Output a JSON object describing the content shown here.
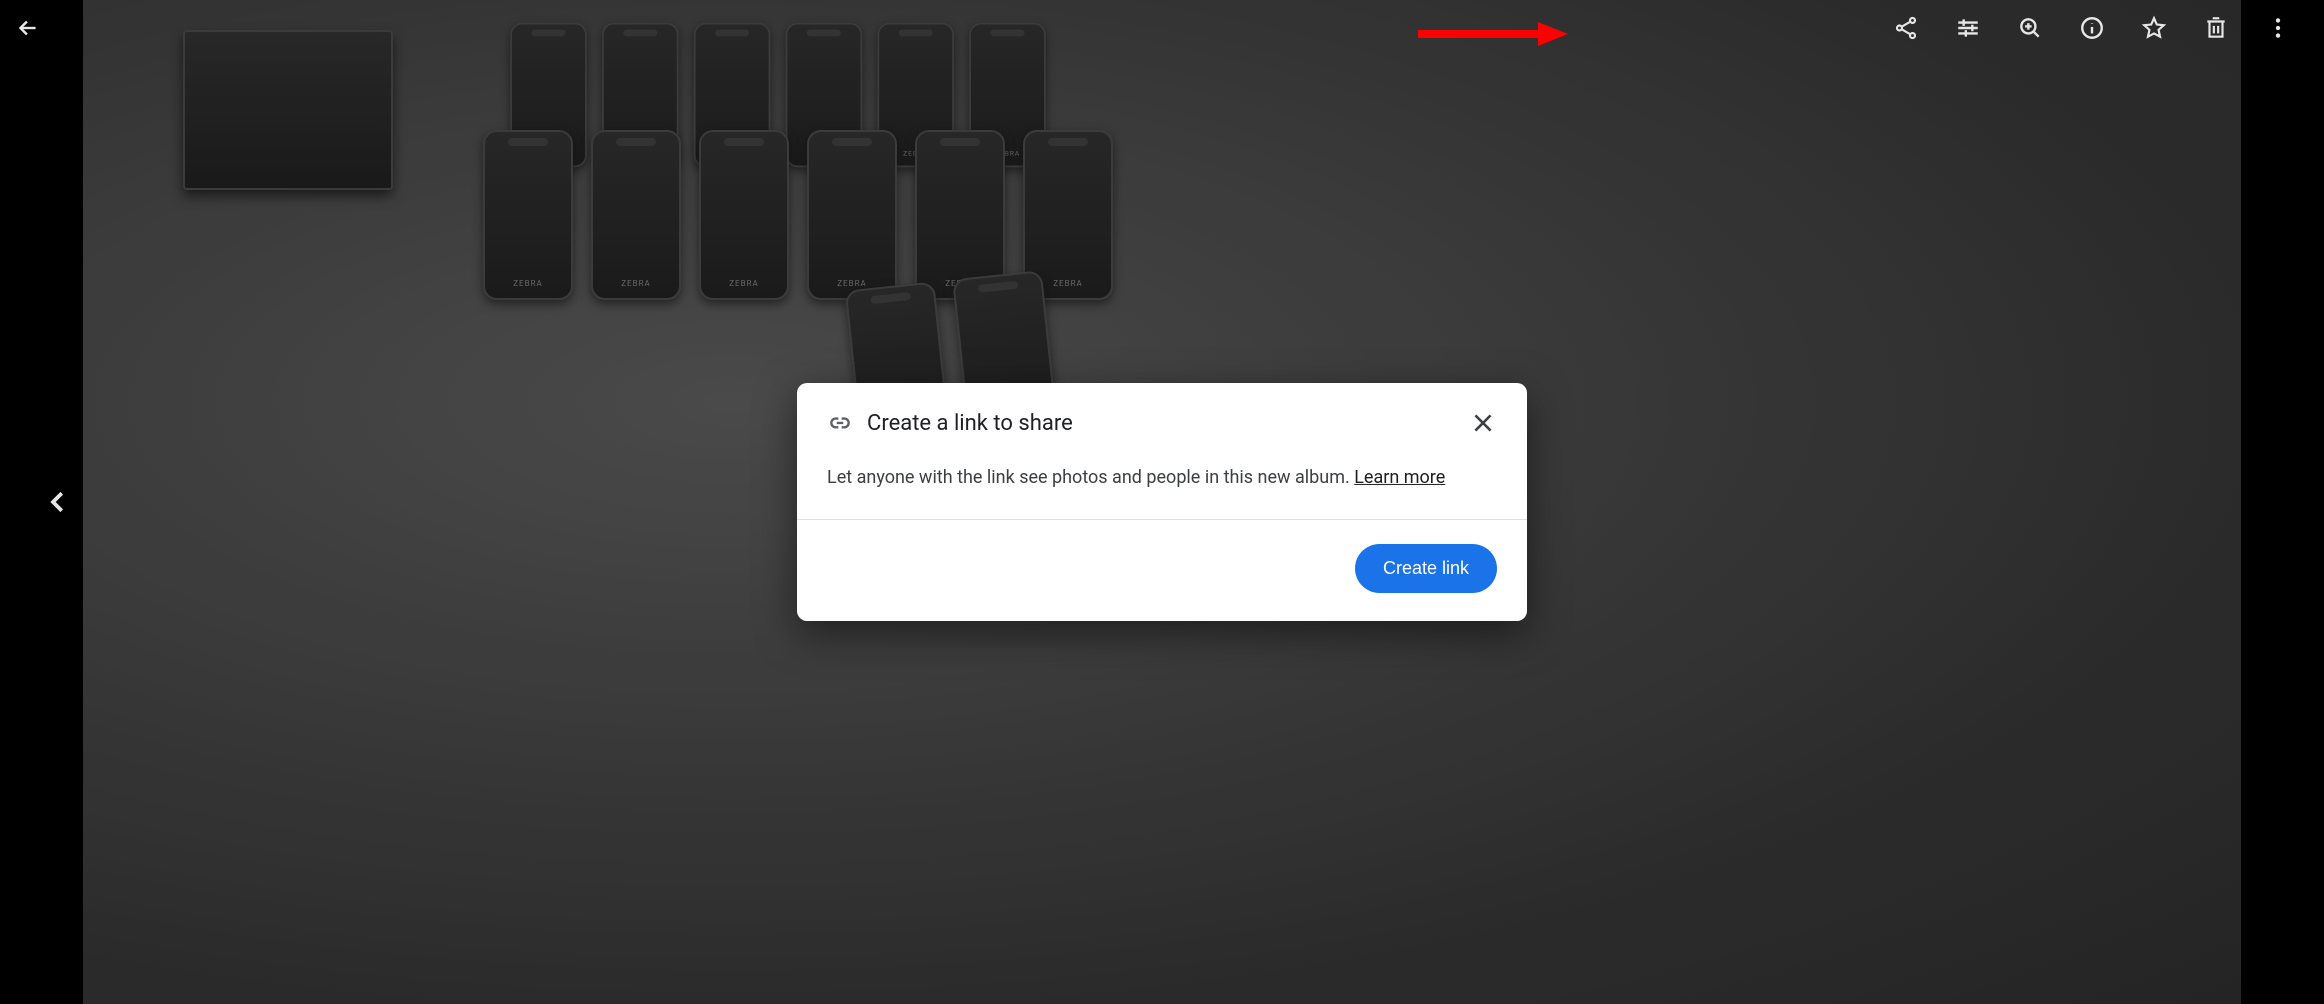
{
  "toolbar": {
    "back_icon": "arrow-back",
    "icons": [
      "share",
      "tune",
      "zoom-in",
      "info",
      "star",
      "delete",
      "more"
    ]
  },
  "nav": {
    "prev_icon": "chevron-left"
  },
  "modal": {
    "title": "Create a link to share",
    "body_text": "Let anyone with the link see photos and people in this new album. ",
    "learn_more": "Learn more",
    "create_button": "Create link",
    "close_icon": "close",
    "link_icon": "link"
  },
  "annotation": {
    "arrow_points_to": "share-icon"
  }
}
